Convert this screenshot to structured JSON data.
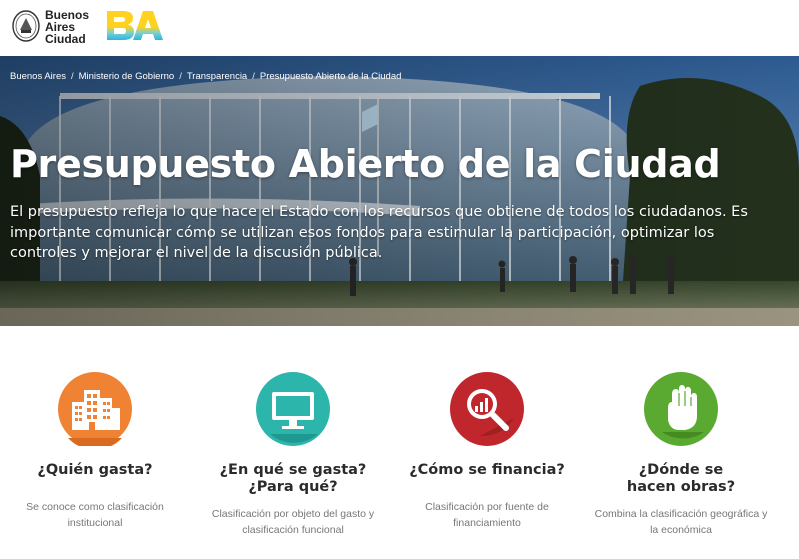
{
  "header": {
    "logo_lines": [
      "Buenos",
      "Aires",
      "Ciudad"
    ],
    "brand_logo": "BA"
  },
  "breadcrumb": [
    "Buenos Aires",
    "Ministerio de Gobierno",
    "Transparencia",
    "Presupuesto Abierto de la Ciudad"
  ],
  "hero": {
    "title": "Presupuesto Abierto de la Ciudad",
    "description": "El presupuesto refleja lo que hace el Estado con los recursos que obtiene de todos los ciudadanos. Es importante comunicar cómo se utilizan esos fondos para estimular la participación, optimizar los controles y mejorar el nivel de la discusión pública."
  },
  "categories": [
    {
      "title": "¿Quién gasta?",
      "description": "Se conoce como clasificación institucional",
      "color": "#f08234",
      "icon": "buildings-icon"
    },
    {
      "title": "¿En qué se gasta? ¿Para qué?",
      "description": "Clasificación por objeto del gasto y clasificación funcional",
      "color": "#2bb5ab",
      "icon": "monitor-icon"
    },
    {
      "title": "¿Cómo se financia?",
      "description": "Clasificación por fuente de financiamiento",
      "color": "#c0272d",
      "icon": "magnifier-chart-icon"
    },
    {
      "title": "¿Dónde se hacen obras?",
      "description": "Combina la clasificación geográfica y la económica",
      "color": "#5aaa32",
      "icon": "hand-icon"
    }
  ]
}
